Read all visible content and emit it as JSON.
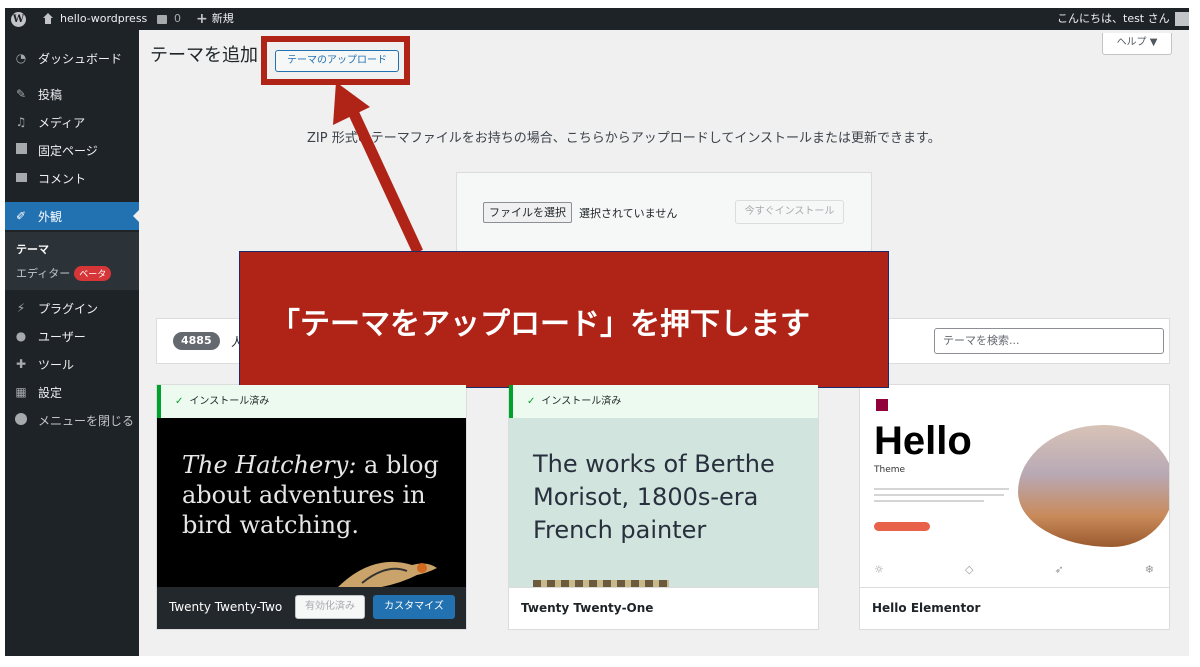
{
  "admin_bar": {
    "wp_logo": "W",
    "site_name": "hello-wordpress",
    "comments_count": "0",
    "new_label": "新規",
    "greeting": "こんにちは、test さん"
  },
  "sidebar": {
    "items": [
      {
        "label": "ダッシュボード",
        "icon": "dashboard-icon"
      },
      {
        "label": "投稿",
        "icon": "pin-icon"
      },
      {
        "label": "メディア",
        "icon": "media-icon"
      },
      {
        "label": "固定ページ",
        "icon": "page-icon"
      },
      {
        "label": "コメント",
        "icon": "comment-icon"
      },
      {
        "label": "外観",
        "icon": "appearance-icon"
      },
      {
        "label": "プラグイン",
        "icon": "plugin-icon"
      },
      {
        "label": "ユーザー",
        "icon": "user-icon"
      },
      {
        "label": "ツール",
        "icon": "wrench-icon"
      },
      {
        "label": "設定",
        "icon": "settings-icon"
      },
      {
        "label": "メニューを閉じる",
        "icon": "collapse-icon"
      }
    ],
    "submenu": {
      "theme": "テーマ",
      "editor": "エディター",
      "beta": "ベータ"
    }
  },
  "main": {
    "page_title": "テーマを追加",
    "upload_button": "テーマのアップロード",
    "help_button": "ヘルプ ▼",
    "upload_description": "ZIP 形式のテーマファイルをお持ちの場合、こちらからアップロードしてインストールまたは更新できます。",
    "choose_file": "ファイルを選択",
    "no_file": "選択されていません",
    "install_now": "今すぐインストール"
  },
  "filter": {
    "count": "4885",
    "popular": "人",
    "search_placeholder": "テーマを検索..."
  },
  "themes": [
    {
      "name": "Twenty Twenty-Two",
      "installed": "インストール済み",
      "preview_text_italic": "The Hatchery:",
      "preview_text": " a blog about adventures in bird watching.",
      "activated": "有効化済み",
      "customize": "カスタマイズ"
    },
    {
      "name": "Twenty Twenty-One",
      "installed": "インストール済み",
      "preview_text": "The works of Berthe Morisot, 1800s-era French painter"
    },
    {
      "name": "Hello Elementor",
      "preview_title": "Hello",
      "preview_sub": "Theme"
    }
  ],
  "annotation": {
    "callout_text": "「テーマをアップロード」を押下します",
    "color": "#b02418"
  }
}
